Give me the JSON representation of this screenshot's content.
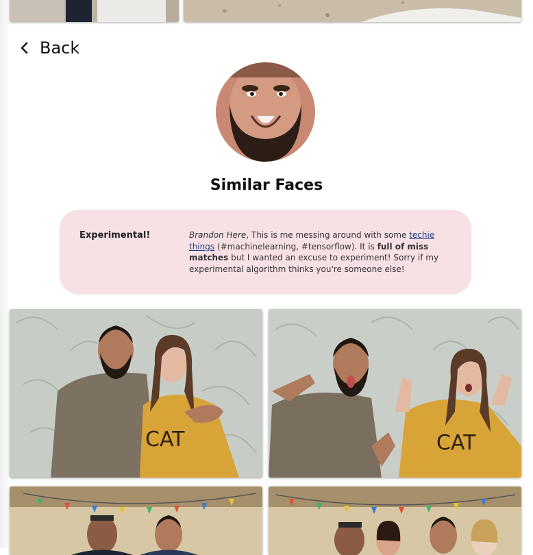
{
  "nav": {
    "back_label": "Back"
  },
  "page": {
    "title": "Similar Faces"
  },
  "notice": {
    "tag": "Experimental!",
    "author": "Brandon Here",
    "text_1": ", This is me messing around with some ",
    "link": "techie things",
    "text_2": " (#machinelearning, #tensorflow). It is ",
    "emphasis": "full of miss matches",
    "text_3": " but I wanted an excuse to experiment! Sorry if my experimental algorithm thinks you're someone else!"
  },
  "colors": {
    "notice_bg": "#f7e1e4",
    "link": "#1f3b8a"
  },
  "photos": [
    {
      "name": "top-photo-left"
    },
    {
      "name": "top-photo-right"
    },
    {
      "name": "result-photo-1"
    },
    {
      "name": "result-photo-2"
    },
    {
      "name": "result-photo-3"
    },
    {
      "name": "result-photo-4"
    }
  ]
}
